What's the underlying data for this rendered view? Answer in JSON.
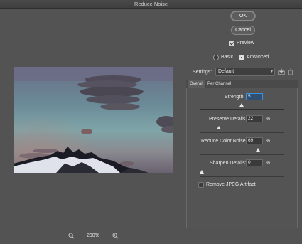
{
  "window": {
    "title": "Reduce Noise"
  },
  "buttons": {
    "ok": "OK",
    "cancel": "Cancel"
  },
  "preview_toggle": {
    "label": "Preview",
    "checked": true
  },
  "mode": {
    "basic": "Basic",
    "advanced": "Advanced",
    "selected": "advanced"
  },
  "settings": {
    "label": "Settings:",
    "value": "Default"
  },
  "tabs": [
    {
      "label": "Overall",
      "active": true
    },
    {
      "label": "Per Channel",
      "active": false
    }
  ],
  "controls": {
    "strength": {
      "label": "Strength:",
      "value": "5",
      "level": 0.5
    },
    "preserve_details": {
      "label": "Preserve Details:",
      "value": "22",
      "unit": "%",
      "level": 0.22
    },
    "reduce_color_noise": {
      "label": "Reduce Color Noise:",
      "value": "69",
      "unit": "%",
      "level": 0.69
    },
    "sharpen_details": {
      "label": "Sharpen Details:",
      "value": "0",
      "unit": "%",
      "level": 0.0
    }
  },
  "remove_jpeg": {
    "label": "Remove JPEG Artifact",
    "checked": false
  },
  "zoom": {
    "value": "200%"
  }
}
